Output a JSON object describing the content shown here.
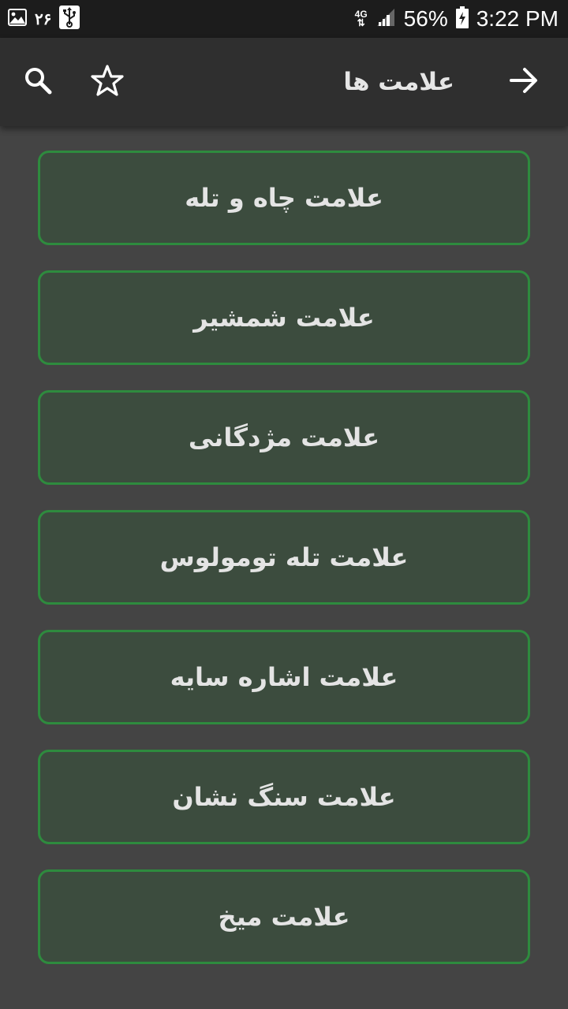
{
  "status_bar": {
    "notification_count": "۲۶",
    "network": "4G",
    "battery": "56%",
    "time": "3:22 PM",
    "icons": [
      "image-icon",
      "usb-icon",
      "signal-icon",
      "battery-charging-icon"
    ]
  },
  "app_bar": {
    "title": "علامت ها",
    "icons": [
      "search-icon",
      "star-icon",
      "arrow-forward-icon"
    ]
  },
  "items": [
    {
      "label": "علامت چاه و تله"
    },
    {
      "label": "علامت شمشیر"
    },
    {
      "label": "علامت مژدگانی"
    },
    {
      "label": "علامت تله تومولوس"
    },
    {
      "label": "علامت اشاره سایه"
    },
    {
      "label": "علامت سنگ نشان"
    },
    {
      "label": "علامت میخ"
    }
  ],
  "colors": {
    "background": "#444444",
    "status_bar": "#1c1c1c",
    "app_bar": "#2f2f2f",
    "card_fill": "#3c4c3e",
    "card_border": "#2e8b3e",
    "text": "#e4e4e4"
  }
}
